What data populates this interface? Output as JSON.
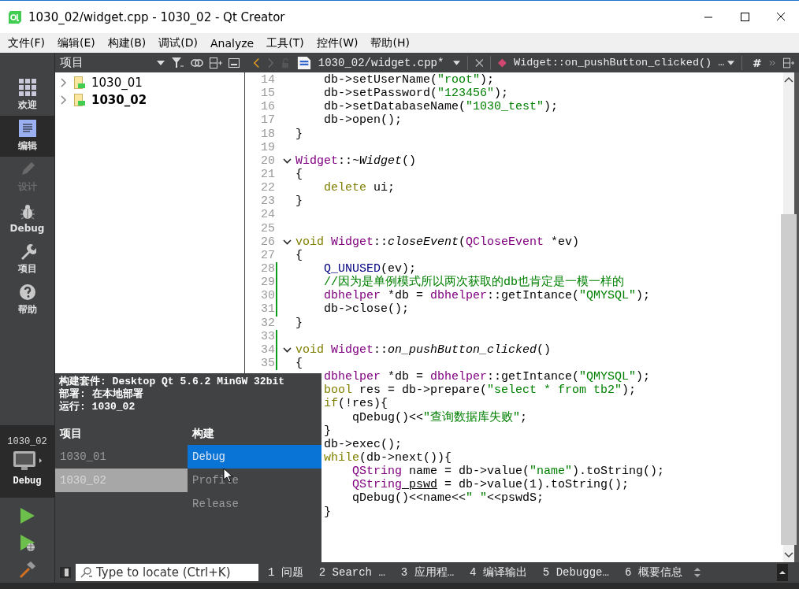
{
  "window": {
    "title": "1030_02/widget.cpp - 1030_02 - Qt Creator"
  },
  "menu": [
    "文件(F)",
    "编辑(E)",
    "构建(B)",
    "调试(D)",
    "Analyze",
    "工具(T)",
    "控件(W)",
    "帮助(H)"
  ],
  "modes": [
    {
      "label": "欢迎",
      "selected": false,
      "disabled": false
    },
    {
      "label": "编辑",
      "selected": true,
      "disabled": false
    },
    {
      "label": "设计",
      "selected": false,
      "disabled": true
    },
    {
      "label": "Debug",
      "selected": false,
      "disabled": false
    },
    {
      "label": "项目",
      "selected": false,
      "disabled": false
    },
    {
      "label": "帮助",
      "selected": false,
      "disabled": false
    }
  ],
  "target": {
    "project": "1030_02",
    "config": "Debug"
  },
  "project_panel": {
    "title": "项目",
    "items": [
      {
        "label": "1030_01",
        "active": false
      },
      {
        "label": "1030_02",
        "active": true
      }
    ]
  },
  "editor": {
    "file": "1030_02/widget.cpp*",
    "symbol": "Widget::on_pushButton_clicked() …",
    "hash": "#",
    "lines": [
      {
        "number": "14",
        "fold": false,
        "changed": false,
        "tokens": [
          {
            "kind": "plain",
            "text": "    db->setUserName("
          },
          {
            "kind": "string",
            "text": "\"root\""
          },
          {
            "kind": "plain",
            "text": ");"
          }
        ]
      },
      {
        "number": "15",
        "fold": false,
        "changed": false,
        "tokens": [
          {
            "kind": "plain",
            "text": "    db->setPassword("
          },
          {
            "kind": "string",
            "text": "\"123456\""
          },
          {
            "kind": "plain",
            "text": ");"
          }
        ]
      },
      {
        "number": "16",
        "fold": false,
        "changed": false,
        "tokens": [
          {
            "kind": "plain",
            "text": "    db->setDatabaseName("
          },
          {
            "kind": "string",
            "text": "\"1030_test\""
          },
          {
            "kind": "plain",
            "text": ");"
          }
        ]
      },
      {
        "number": "17",
        "fold": false,
        "changed": false,
        "tokens": [
          {
            "kind": "plain",
            "text": "    db->open();"
          }
        ]
      },
      {
        "number": "18",
        "fold": false,
        "changed": false,
        "tokens": [
          {
            "kind": "plain",
            "text": "}"
          }
        ]
      },
      {
        "number": "19",
        "fold": false,
        "changed": false
      },
      {
        "number": "20",
        "fold": true,
        "changed": false,
        "tokens": [
          {
            "kind": "type",
            "text": "Widget"
          },
          {
            "kind": "plain",
            "text": "::"
          },
          {
            "kind": "function",
            "text": "~Widget"
          },
          {
            "kind": "plain",
            "text": "()"
          }
        ]
      },
      {
        "number": "21",
        "fold": false,
        "changed": false,
        "tokens": [
          {
            "kind": "plain",
            "text": "{"
          }
        ]
      },
      {
        "number": "22",
        "fold": false,
        "changed": false,
        "tokens": [
          {
            "kind": "keyword",
            "text": "    delete"
          },
          {
            "kind": "plain",
            "text": " ui;"
          }
        ]
      },
      {
        "number": "23",
        "fold": false,
        "changed": false,
        "tokens": [
          {
            "kind": "plain",
            "text": "}"
          }
        ]
      },
      {
        "number": "24",
        "fold": false,
        "changed": false
      },
      {
        "number": "25",
        "fold": false,
        "changed": false
      },
      {
        "number": "26",
        "fold": true,
        "changed": false,
        "tokens": [
          {
            "kind": "keyword",
            "text": "void"
          },
          {
            "kind": "type",
            "text": " Widget"
          },
          {
            "kind": "plain",
            "text": "::"
          },
          {
            "kind": "function",
            "text": "closeEvent"
          },
          {
            "kind": "plain",
            "text": "("
          },
          {
            "kind": "type",
            "text": "QCloseEvent"
          },
          {
            "kind": "plain",
            "text": " *ev)"
          }
        ]
      },
      {
        "number": "27",
        "fold": false,
        "changed": false,
        "tokens": [
          {
            "kind": "plain",
            "text": "{"
          }
        ]
      },
      {
        "number": "28",
        "fold": false,
        "changed": true,
        "tokens": [
          {
            "kind": "macro",
            "text": "    Q_UNUSED"
          },
          {
            "kind": "plain",
            "text": "(ev);"
          }
        ]
      },
      {
        "number": "29",
        "fold": false,
        "changed": true,
        "tokens": [
          {
            "kind": "comment",
            "text": "    //因为是单例模式所以两次获取的db也肯定是一模一样的"
          }
        ]
      },
      {
        "number": "30",
        "fold": false,
        "changed": true,
        "tokens": [
          {
            "kind": "type",
            "text": "    dbhelper"
          },
          {
            "kind": "plain",
            "text": " *db = "
          },
          {
            "kind": "type",
            "text": "dbhelper"
          },
          {
            "kind": "plain",
            "text": "::getIntance("
          },
          {
            "kind": "string",
            "text": "\"QMYSQL\""
          },
          {
            "kind": "plain",
            "text": ");"
          }
        ]
      },
      {
        "number": "31",
        "fold": false,
        "changed": true,
        "tokens": [
          {
            "kind": "plain",
            "text": "    db->close();"
          }
        ]
      },
      {
        "number": "32",
        "fold": false,
        "changed": false,
        "tokens": [
          {
            "kind": "plain",
            "text": "}"
          }
        ]
      },
      {
        "number": "33",
        "fold": false,
        "changed": true
      },
      {
        "number": "34",
        "fold": true,
        "changed": true,
        "tokens": [
          {
            "kind": "keyword",
            "text": "void"
          },
          {
            "kind": "type",
            "text": " Widget"
          },
          {
            "kind": "plain",
            "text": "::"
          },
          {
            "kind": "function",
            "text": "on_pushButton_clicked"
          },
          {
            "kind": "plain",
            "text": "()"
          }
        ]
      },
      {
        "number": "35",
        "fold": false,
        "changed": true,
        "tokens": [
          {
            "kind": "plain",
            "text": "{"
          }
        ]
      },
      {
        "tokens": [
          {
            "kind": "type",
            "text": "    dbhelper"
          },
          {
            "kind": "plain",
            "text": " *db = "
          },
          {
            "kind": "type",
            "text": "dbhelper"
          },
          {
            "kind": "plain",
            "text": "::getIntance("
          },
          {
            "kind": "string",
            "text": "\"QMYSQL\""
          },
          {
            "kind": "plain",
            "text": ");"
          }
        ]
      },
      {
        "tokens": [
          {
            "kind": "keyword",
            "text": "    bool"
          },
          {
            "kind": "plain",
            "text": " res = db->prepare("
          },
          {
            "kind": "string",
            "text": "\"select * from tb2\""
          },
          {
            "kind": "plain",
            "text": ");"
          }
        ]
      },
      {
        "tokens": [
          {
            "kind": "keyword",
            "text": "    if"
          },
          {
            "kind": "plain",
            "text": "(!res){"
          }
        ]
      },
      {
        "tokens": [
          {
            "kind": "plain",
            "text": "        qDebug()<<"
          },
          {
            "kind": "string",
            "text": "\"查询数据库失败\""
          },
          {
            "kind": "plain",
            "text": ";"
          }
        ]
      },
      {
        "tokens": [
          {
            "kind": "plain",
            "text": "    }"
          }
        ]
      },
      {
        "tokens": [
          {
            "kind": "plain",
            "text": "    db->exec();"
          }
        ]
      },
      {
        "tokens": [
          {
            "kind": "keyword",
            "text": "    while"
          },
          {
            "kind": "plain",
            "text": "(db->next()){"
          }
        ]
      },
      {
        "tokens": [
          {
            "kind": "type",
            "text": "        QString"
          },
          {
            "kind": "plain",
            "text": " name = db->value("
          },
          {
            "kind": "string",
            "text": "\"name\""
          },
          {
            "kind": "plain",
            "text": ").toString();"
          }
        ]
      },
      {
        "tokens": [
          {
            "kind": "type",
            "text": "        QString"
          },
          {
            "kind": "warning",
            "text": " pswd"
          },
          {
            "kind": "plain",
            "text": " = db->value(1).toString();"
          }
        ]
      },
      {
        "tokens": [
          {
            "kind": "plain",
            "text": "        qDebug()<<name<<"
          },
          {
            "kind": "string",
            "text": "\" \""
          },
          {
            "kind": "plain",
            "text": "<<pswdS;"
          }
        ]
      },
      {
        "tokens": [
          {
            "kind": "plain",
            "text": "    }"
          }
        ]
      }
    ]
  },
  "kit_popup": {
    "info": [
      "构建套件: Desktop Qt 5.6.2 MinGW 32bit",
      "部署: 在本地部署",
      "运行: 1030_02"
    ],
    "project_header": "项目",
    "build_header": "构建",
    "projects": [
      {
        "label": "1030_01",
        "selected": false
      },
      {
        "label": "1030_02",
        "selected": true
      }
    ],
    "builds": [
      {
        "label": "Debug",
        "selected": true
      },
      {
        "label": "Profile",
        "selected": false
      },
      {
        "label": "Release",
        "selected": false
      }
    ]
  },
  "locator": {
    "placeholder": "Type to locate (Ctrl+K)"
  },
  "output_tabs": [
    "1 问题",
    "2 Search …",
    "3 应用程…",
    "4 编译输出",
    "5 Debugge…",
    "6 概要信息"
  ]
}
